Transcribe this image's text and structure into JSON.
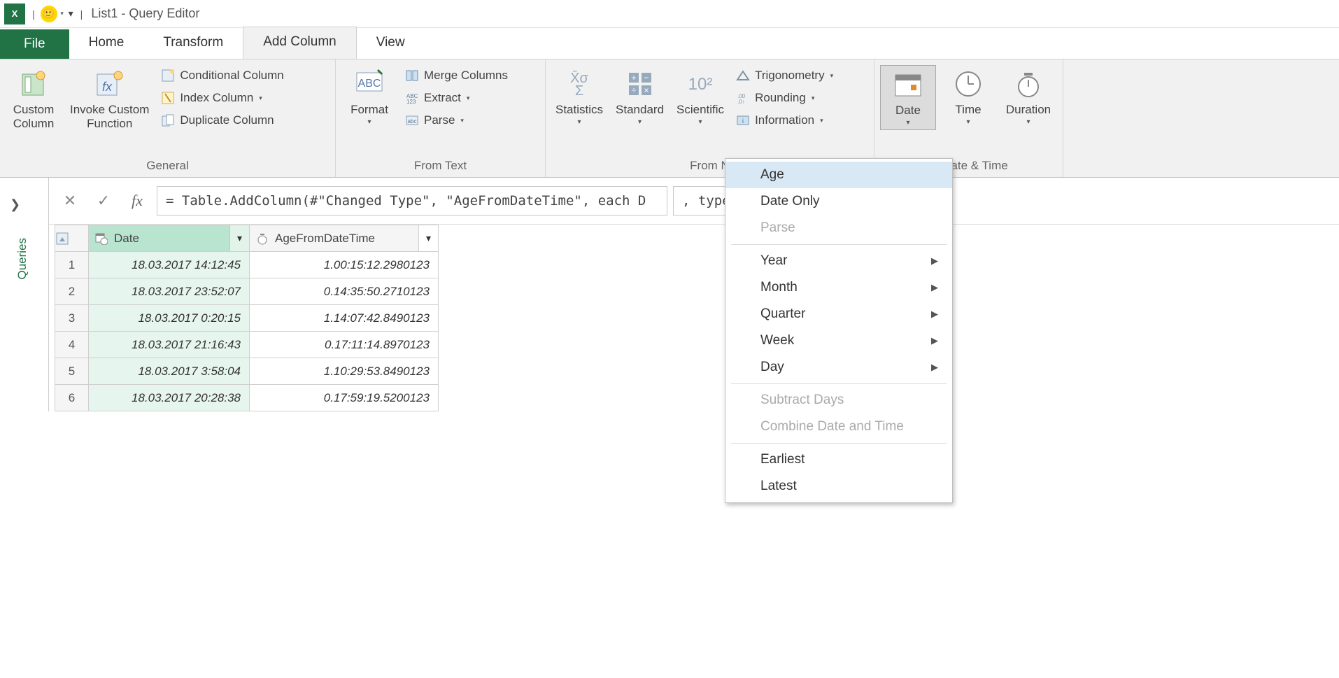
{
  "title_bar": {
    "app_label": "X",
    "window_title": "List1 - Query Editor"
  },
  "tabs": {
    "file": "File",
    "home": "Home",
    "transform": "Transform",
    "add_column": "Add Column",
    "view": "View"
  },
  "ribbon": {
    "general": {
      "label": "General",
      "custom_column": "Custom\nColumn",
      "invoke_custom_function": "Invoke Custom\nFunction",
      "conditional_column": "Conditional Column",
      "index_column": "Index Column",
      "duplicate_column": "Duplicate Column"
    },
    "from_text": {
      "label": "From Text",
      "format": "Format",
      "merge_columns": "Merge Columns",
      "extract": "Extract",
      "parse": "Parse"
    },
    "from_number": {
      "label_full": "From Number",
      "label_visible": "From N",
      "statistics": "Statistics",
      "standard": "Standard",
      "scientific": "Scientific",
      "trigonometry": "Trigonometry",
      "rounding": "Rounding",
      "information": "Information"
    },
    "from_datetime": {
      "label_full": "From Date & Time",
      "label_visible": "m Date & Time",
      "date": "Date",
      "time": "Time",
      "duration": "Duration"
    }
  },
  "date_menu": {
    "age": "Age",
    "date_only": "Date Only",
    "parse": "Parse",
    "year": "Year",
    "month": "Month",
    "quarter": "Quarter",
    "week": "Week",
    "day": "Day",
    "subtract_days": "Subtract Days",
    "combine": "Combine Date and Time",
    "earliest": "Earliest",
    "latest": "Latest"
  },
  "formula_bar": {
    "value_left": "= Table.AddColumn(#\"Changed Type\", \"AgeFromDateTime\", each D",
    "value_right": ", type duration)"
  },
  "queries_pane": {
    "label": "Queries"
  },
  "table": {
    "columns": {
      "date": "Date",
      "age": "AgeFromDateTime"
    },
    "rows": [
      {
        "n": "1",
        "date": "18.03.2017 14:12:45",
        "age": "1.00:15:12.2980123"
      },
      {
        "n": "2",
        "date": "18.03.2017 23:52:07",
        "age": "0.14:35:50.2710123"
      },
      {
        "n": "3",
        "date": "18.03.2017 0:20:15",
        "age": "1.14:07:42.8490123"
      },
      {
        "n": "4",
        "date": "18.03.2017 21:16:43",
        "age": "0.17:11:14.8970123"
      },
      {
        "n": "5",
        "date": "18.03.2017 3:58:04",
        "age": "1.10:29:53.8490123"
      },
      {
        "n": "6",
        "date": "18.03.2017 20:28:38",
        "age": "0.17:59:19.5200123"
      }
    ]
  }
}
